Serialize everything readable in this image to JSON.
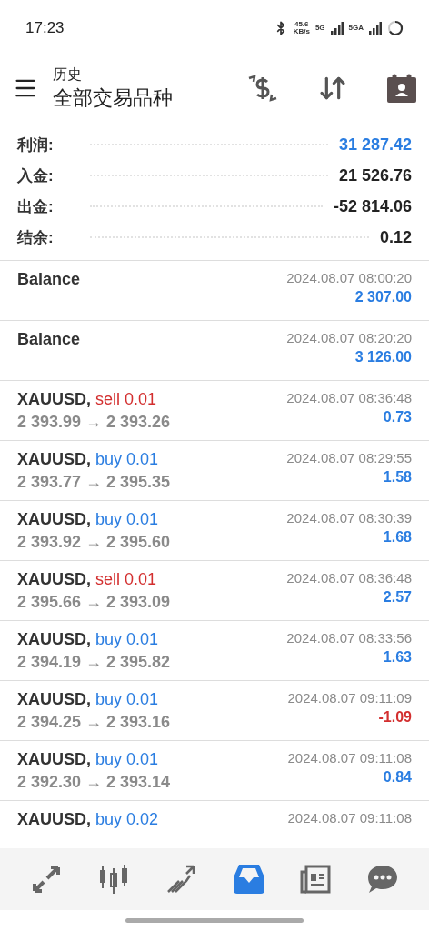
{
  "status_bar": {
    "time": "17:23",
    "speed_value": "45.6",
    "speed_unit": "KB/s",
    "network_1": "5G",
    "network_2": "5GA"
  },
  "header": {
    "title": "历史",
    "subtitle": "全部交易品种"
  },
  "summary": [
    {
      "label": "利润:",
      "value": "31 287.42",
      "highlight": true
    },
    {
      "label": "入金:",
      "value": "21 526.76",
      "highlight": false
    },
    {
      "label": "出金:",
      "value": "-52 814.06",
      "highlight": false
    },
    {
      "label": "结余:",
      "value": "0.12",
      "highlight": false
    }
  ],
  "deals": [
    {
      "kind": "balance",
      "symbol": "Balance",
      "time": "2024.08.07 08:00:20",
      "profit": "2 307.00",
      "negative": false
    },
    {
      "kind": "balance",
      "symbol": "Balance",
      "time": "2024.08.07 08:20:20",
      "profit": "3 126.00",
      "negative": false
    },
    {
      "kind": "trade",
      "symbol": "XAUUSD,",
      "color": "#d32f2f",
      "order": "sell 0.01",
      "prices": "2 393.99 → 2 393.26",
      "time": "2024.08.07 08:36:48",
      "profit": "0.73",
      "negative": false
    },
    {
      "kind": "trade",
      "symbol": "XAUUSD,",
      "color": "#2a7de1",
      "order": "buy 0.01",
      "prices": "2 393.77 → 2 395.35",
      "time": "2024.08.07 08:29:55",
      "profit": "1.58",
      "negative": false
    },
    {
      "kind": "trade",
      "symbol": "XAUUSD,",
      "color": "#2a7de1",
      "order": "buy 0.01",
      "prices": "2 393.92 → 2 395.60",
      "time": "2024.08.07 08:30:39",
      "profit": "1.68",
      "negative": false
    },
    {
      "kind": "trade",
      "symbol": "XAUUSD,",
      "color": "#d32f2f",
      "order": "sell 0.01",
      "prices": "2 395.66 → 2 393.09",
      "time": "2024.08.07 08:36:48",
      "profit": "2.57",
      "negative": false
    },
    {
      "kind": "trade",
      "symbol": "XAUUSD,",
      "color": "#2a7de1",
      "order": "buy 0.01",
      "prices": "2 394.19 → 2 395.82",
      "time": "2024.08.07 08:33:56",
      "profit": "1.63",
      "negative": false
    },
    {
      "kind": "trade",
      "symbol": "XAUUSD,",
      "color": "#2a7de1",
      "order": "buy 0.01",
      "prices": "2 394.25 → 2 393.16",
      "time": "2024.08.07 09:11:09",
      "profit": "-1.09",
      "negative": true
    },
    {
      "kind": "trade",
      "symbol": "XAUUSD,",
      "color": "#2a7de1",
      "order": "buy 0.01",
      "prices": "2 392.30 → 2 393.14",
      "time": "2024.08.07 09:11:08",
      "profit": "0.84",
      "negative": false
    },
    {
      "kind": "trade",
      "symbol": "XAUUSD,",
      "color": "#2a7de1",
      "order": "buy 0.02",
      "time": "2024.08.07 09:11:08"
    }
  ],
  "nav": [
    {
      "kind": "trade",
      "selected": false
    },
    {
      "kind": "quotes",
      "selected": false
    },
    {
      "kind": "chart",
      "selected": false
    },
    {
      "kind": "history",
      "selected": true
    },
    {
      "kind": "news",
      "selected": false
    },
    {
      "kind": "chat",
      "selected": false
    }
  ]
}
